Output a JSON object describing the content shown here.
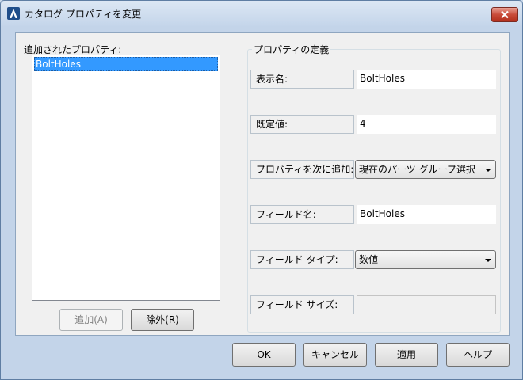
{
  "window": {
    "title": "カタログ プロパティを変更"
  },
  "left": {
    "label": "追加されたプロパティ:",
    "items": [
      "BoltHoles"
    ],
    "add_button": "追加(A)",
    "remove_button": "除外(R)"
  },
  "props": {
    "legend": "プロパティの定義",
    "display_name": {
      "label": "表示名:",
      "value": "BoltHoles"
    },
    "default_value": {
      "label": "既定値:",
      "value": "4"
    },
    "add_to": {
      "label": "プロパティを次に追加:",
      "value": "現在のパーツ グループ選択"
    },
    "field_name": {
      "label": "フィールド名:",
      "value": "BoltHoles"
    },
    "field_type": {
      "label": "フィールド タイプ:",
      "value": "数値"
    },
    "field_size": {
      "label": "フィールド サイズ:",
      "value": ""
    }
  },
  "footer": {
    "ok": "OK",
    "cancel": "キャンセル",
    "apply": "適用",
    "help": "ヘルプ"
  },
  "colors": {
    "selection": "#3399ff",
    "close_button": "#c94b39",
    "dialog_bg": "#f0f0f0",
    "frame": "#c3d4e9"
  },
  "icons": {
    "app": "autocad-a-icon",
    "close": "close-x-icon",
    "dropdown": "chevron-down-icon"
  }
}
